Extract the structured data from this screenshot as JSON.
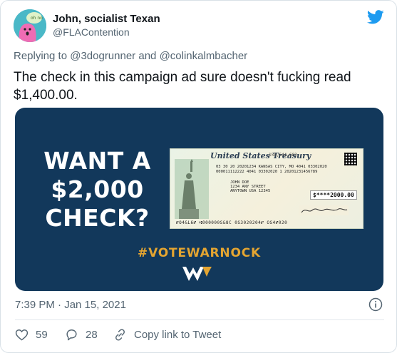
{
  "tweet": {
    "author": {
      "display_name": "John, socialist Texan",
      "handle": "@FLAContention",
      "avatar_icon": "pink-blob-avatar",
      "avatar_bubble_text": "oh no"
    },
    "platform_icon": "twitter-bird-icon",
    "brand_color": "#1d9bf0",
    "replying_to": {
      "prefix": "Replying to",
      "mention_1": "@3dogrunner",
      "conjunction": "and",
      "mention_2": "@colinkalmbacher"
    },
    "text": "The check in this campaign ad sure doesn't fucking read $1,400.00.",
    "timestamp": "7:39 PM · Jan 15, 2021",
    "info_icon": "info-icon",
    "actions": {
      "likes_icon": "heart-icon",
      "likes": "59",
      "replies_icon": "reply-bubble-icon",
      "replies": "28",
      "copy_icon": "link-icon",
      "copy_label": "Copy link to Tweet"
    }
  },
  "ad": {
    "background_color": "#12385b",
    "headline_line1": "WANT A",
    "headline_line2": "$2,000",
    "headline_line3": "CHECK?",
    "hashtag": "#VOTEWARNOCK",
    "hashtag_color": "#e4a531",
    "logo_icon": "warnock-w-logo",
    "check": {
      "title": "United States Treasury",
      "serial": "158,644,602",
      "line1": "03 30 20 20201234  KANSAS CITY, MO    4041 03302020",
      "line2": "000011112222    4041 03302020 1    20201231456789",
      "payee_1": "JOHN DOE",
      "payee_2": "1234 ANY STREET",
      "payee_3": "ANYTOWN USA 12345",
      "amount": "$****2000.00",
      "micr": "⑈O4&L6⑈   ⑆000000S&8C  0S3020204⑈  OS4⑈020",
      "statue_icon": "statue-of-liberty-icon",
      "qr_icon": "qr-code-icon"
    }
  }
}
